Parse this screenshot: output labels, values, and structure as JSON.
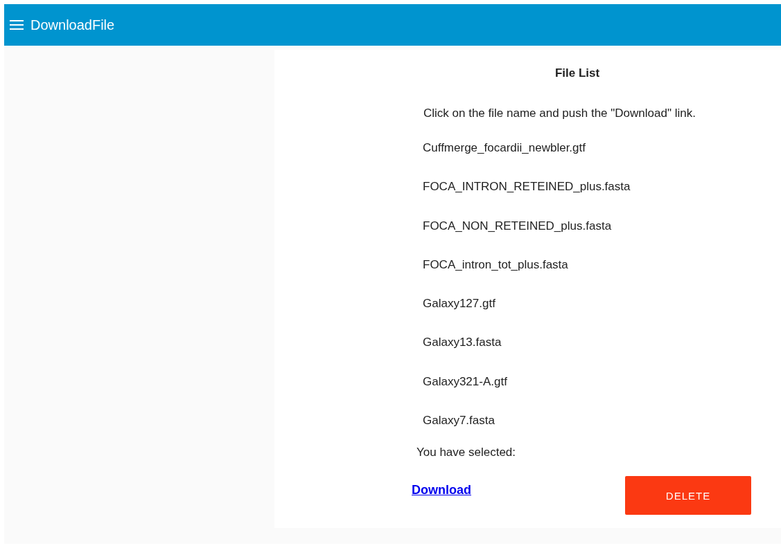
{
  "app_bar": {
    "title": "DownloadFile"
  },
  "panel": {
    "title": "File List",
    "instruction": "Click on the file name and push the \"Download\" link.",
    "files": [
      "Cuffmerge_focardii_newbler.gtf",
      "FOCA_INTRON_RETEINED_plus.fasta",
      "FOCA_NON_RETEINED_plus.fasta",
      "FOCA_intron_tot_plus.fasta",
      "Galaxy127.gtf",
      "Galaxy13.fasta",
      "Galaxy321-A.gtf",
      "Galaxy7.fasta"
    ],
    "selected_label": "You have selected:",
    "download_link": "Download",
    "delete_button": "DELETE"
  }
}
